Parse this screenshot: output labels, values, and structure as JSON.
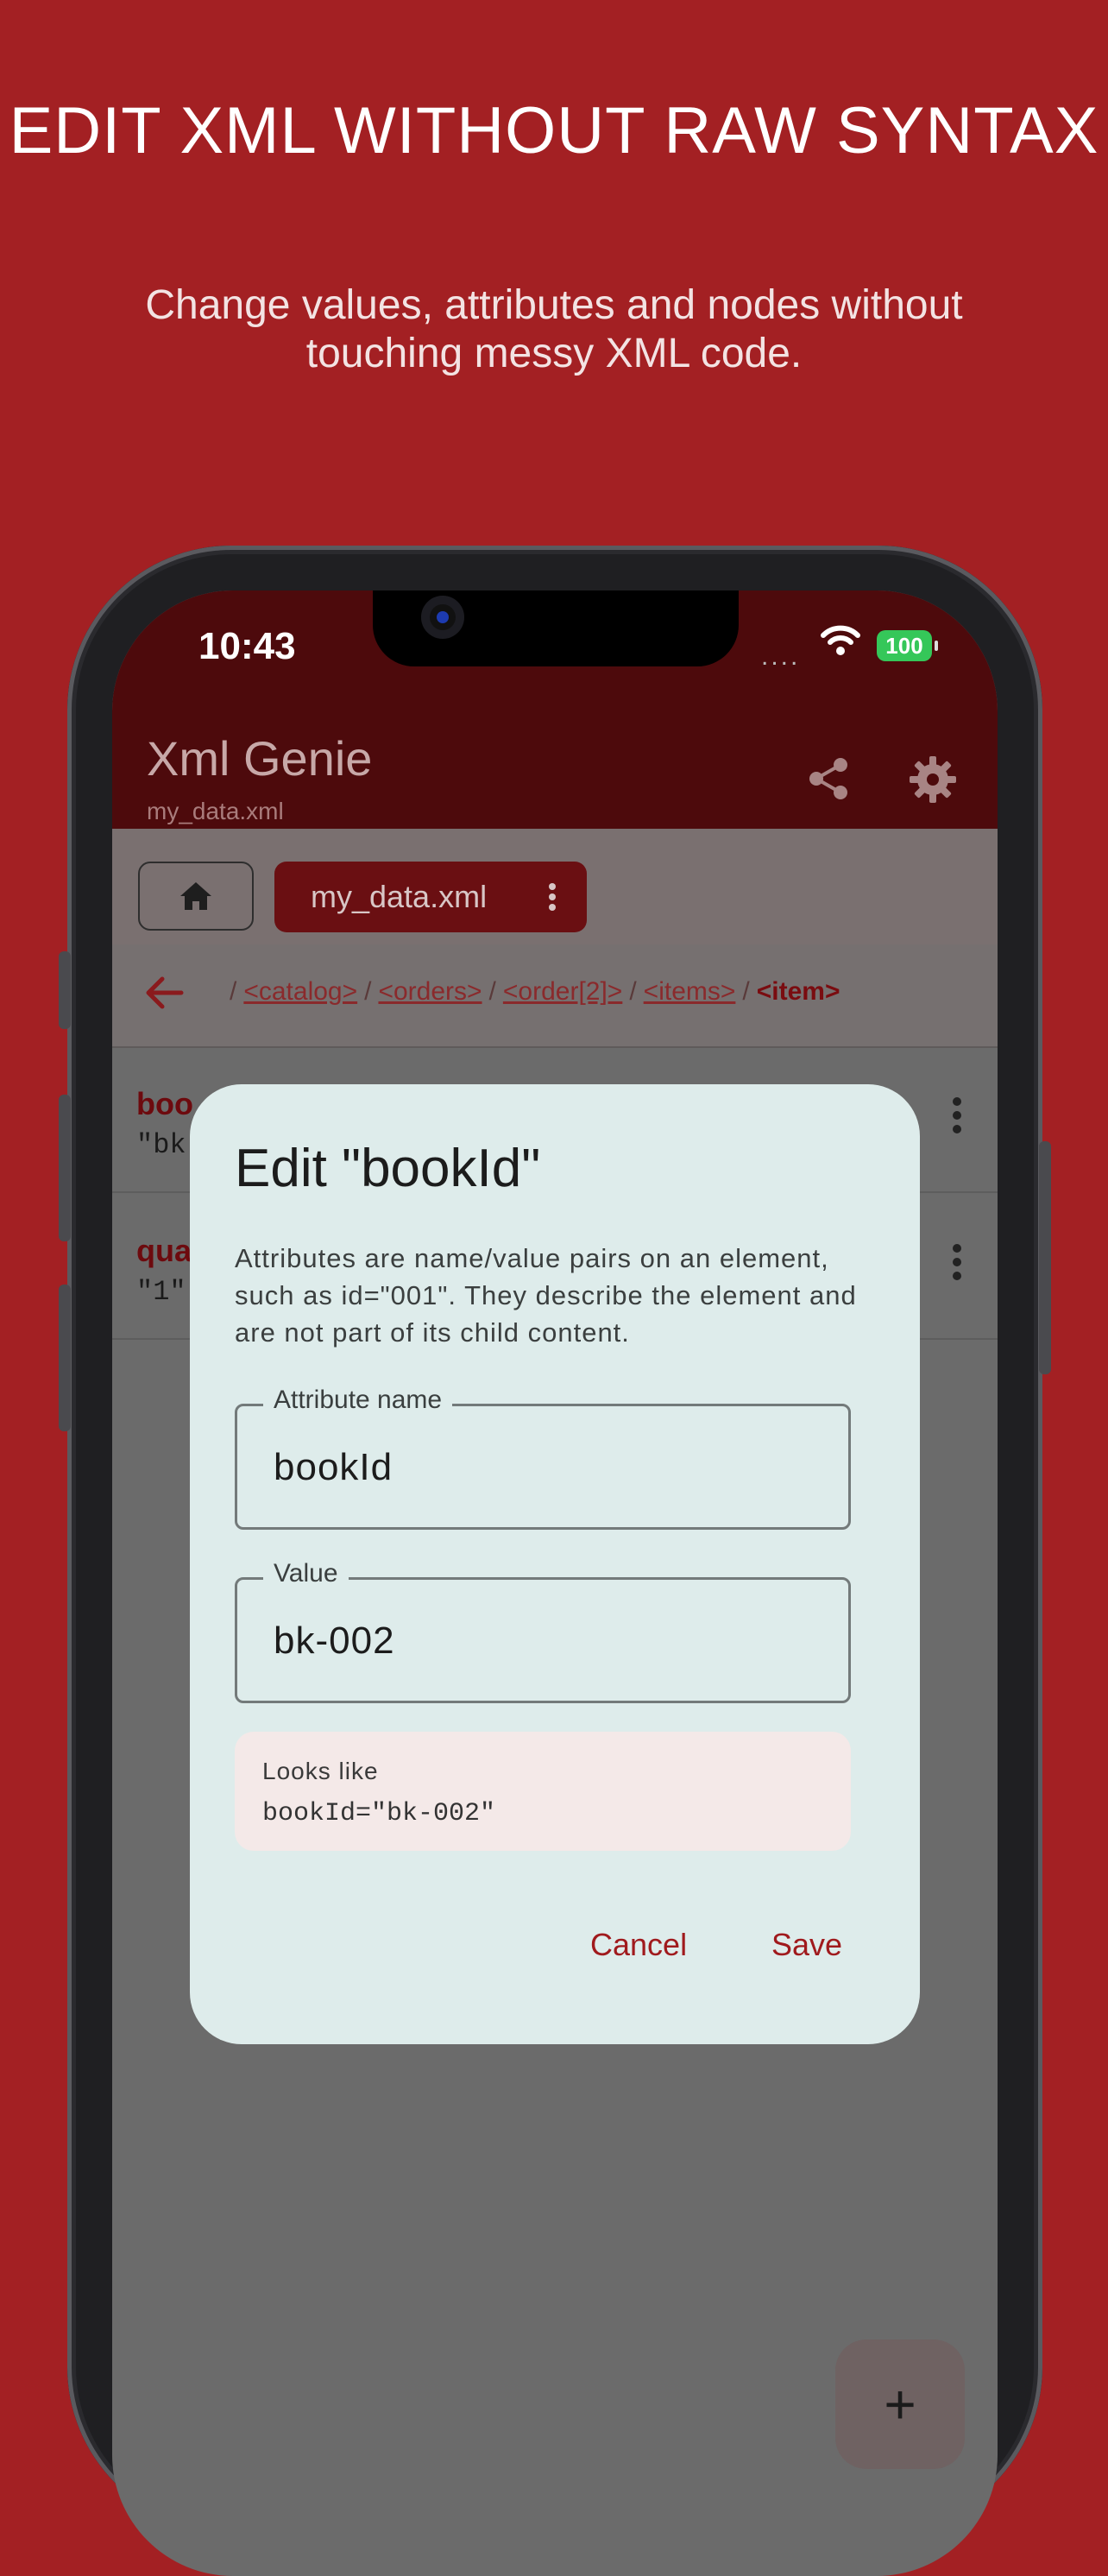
{
  "promo": {
    "headline": "EDIT XML WITHOUT RAW SYNTAX",
    "subheadline": "Change values, attributes and nodes without touching messy XML code."
  },
  "status_bar": {
    "time": "10:43",
    "signal": "....",
    "battery": "100"
  },
  "app_bar": {
    "title": "Xml Genie",
    "subtitle": "my_data.xml",
    "share_icon": "share-icon",
    "settings_icon": "gear-icon"
  },
  "tabs": {
    "home_icon": "home-icon",
    "file_chip_label": "my_data.xml"
  },
  "breadcrumb": {
    "separator": "/",
    "items": [
      "<catalog>",
      "<orders>",
      "<order[2]>",
      "<items>"
    ],
    "current": "<item>"
  },
  "list": {
    "items": [
      {
        "name": "boo",
        "value": "\"bk-"
      },
      {
        "name": "qua",
        "value": "\"1\""
      }
    ]
  },
  "dialog": {
    "title": "Edit \"bookId\"",
    "description": "Attributes are name/value pairs on an element, such as id=\"001\". They describe the element and are not part of its child content.",
    "name_field": {
      "label": "Attribute name",
      "value": "bookId"
    },
    "value_field": {
      "label": "Value",
      "value": "bk-002"
    },
    "preview": {
      "label": "Looks like",
      "code": "bookId=\"bk-002\""
    },
    "cancel_label": "Cancel",
    "save_label": "Save"
  },
  "fab": {
    "label": "+"
  },
  "colors": {
    "background": "#a32023",
    "app_bar": "#4d0a0c",
    "dialog": "#deeceb",
    "accent": "#a01a1d"
  }
}
